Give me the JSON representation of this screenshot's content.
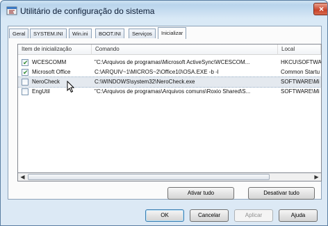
{
  "window": {
    "title": "Utilitário de configuração do sistema"
  },
  "tabs": [
    {
      "label": "Geral"
    },
    {
      "label": "SYSTEM.INI"
    },
    {
      "label": "Win.ini"
    },
    {
      "label": "BOOT.INI"
    },
    {
      "label": "Serviços"
    },
    {
      "label": "Inicializar"
    }
  ],
  "list": {
    "columns": [
      "Item de inicialização",
      "Comando",
      "Local"
    ],
    "rows": [
      {
        "checked": true,
        "item": "WCESCOMM",
        "command": "\"C:\\Arquivos de programas\\Microsoft ActiveSync\\WCESCOM...",
        "location": "HKCU\\SOFTWA"
      },
      {
        "checked": true,
        "item": "Microsoft Office",
        "command": "C:\\ARQUIV~1\\MICROS~2\\Office10\\OSA.EXE -b -l",
        "location": "Common Startu"
      },
      {
        "checked": false,
        "item": "NeroCheck",
        "command": "C:\\WINDOWS\\system32\\NeroCheck.exe",
        "location": "SOFTWARE\\Mi"
      },
      {
        "checked": false,
        "item": "EngUtil",
        "command": "\"C:\\Arquivos de programas\\Arquivos comuns\\Roxio Shared\\S...",
        "location": "SOFTWARE\\Mi"
      }
    ]
  },
  "buttons": {
    "enable_all": "Ativar tudo",
    "disable_all": "Desativar tudo",
    "ok": "OK",
    "cancel": "Cancelar",
    "apply": "Aplicar",
    "help": "Ajuda"
  },
  "colors": {
    "selection": "#e4e9ef",
    "check": "#2f8a2f",
    "title_bg": "#b9d4ec"
  }
}
